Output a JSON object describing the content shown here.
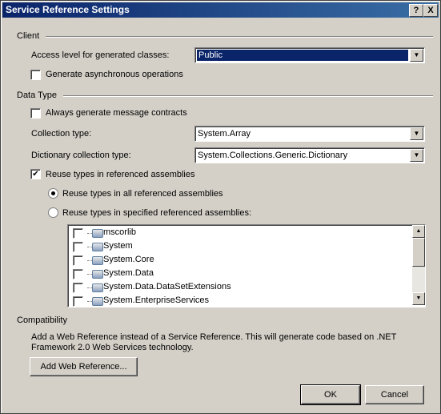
{
  "window": {
    "title": "Service Reference Settings",
    "help_button": "?",
    "close_button": "X"
  },
  "client": {
    "header": "Client",
    "access_level_label": "Access level for generated classes:",
    "access_level_value": "Public",
    "async_label": "Generate asynchronous operations",
    "async_checked": false
  },
  "data_type": {
    "header": "Data Type",
    "always_generate_label": "Always generate message contracts",
    "always_generate_checked": false,
    "collection_type_label": "Collection type:",
    "collection_type_value": "System.Array",
    "dictionary_label": "Dictionary collection type:",
    "dictionary_value": "System.Collections.Generic.Dictionary",
    "reuse_label": "Reuse types in referenced assemblies",
    "reuse_checked": true,
    "reuse_all_label": "Reuse types in all referenced assemblies",
    "reuse_all_selected": true,
    "reuse_specified_label": "Reuse types in specified referenced assemblies:",
    "assemblies": [
      "mscorlib",
      "System",
      "System.Core",
      "System.Data",
      "System.Data.DataSetExtensions",
      "System.EnterpriseServices"
    ]
  },
  "compatibility": {
    "header": "Compatibility",
    "description_line1": "Add a Web Reference instead of a Service Reference. This will generate code based on .NET",
    "description_line2": "Framework 2.0 Web Services technology.",
    "add_web_reference_button": "Add Web Reference..."
  },
  "buttons": {
    "ok": "OK",
    "cancel": "Cancel"
  },
  "colors": {
    "titlebar_start": "#0a246a",
    "titlebar_end": "#3a6ea5",
    "dialog_bg": "#d4d0c8",
    "selection": "#0a246a"
  }
}
